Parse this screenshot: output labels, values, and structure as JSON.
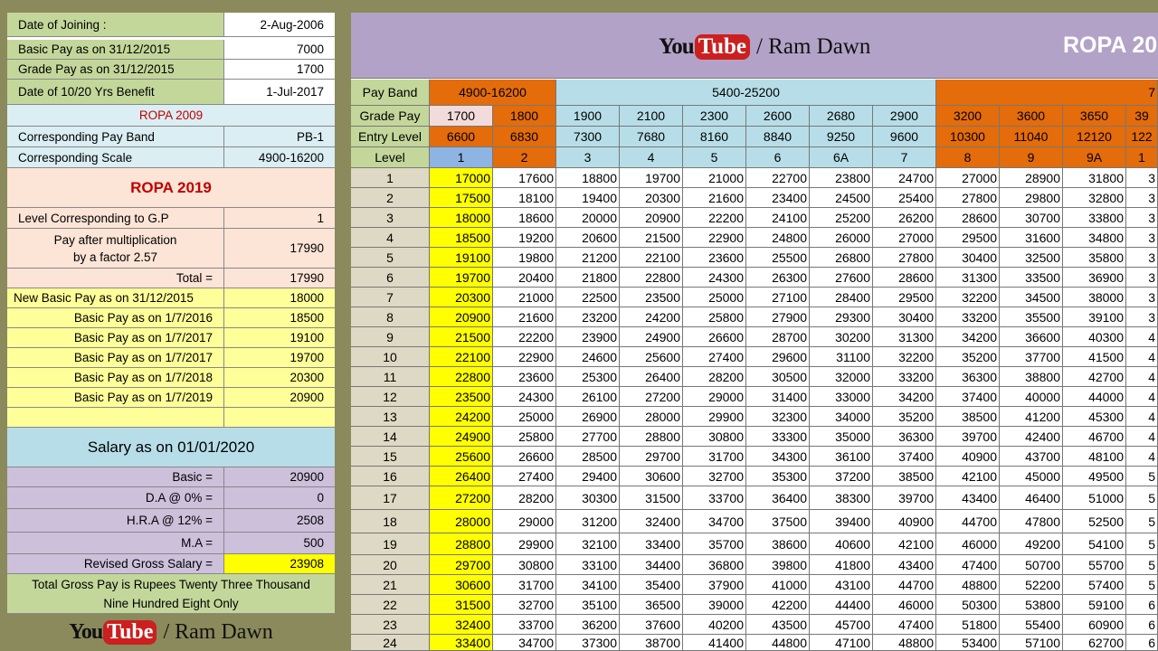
{
  "colors": {
    "green": "#c4d79b",
    "cyan": "#daeef3",
    "peach": "#fce4d6",
    "yellow": "#ffff99",
    "lavender": "#ccc0da",
    "pink": "#f2dcdb",
    "orange": "#e46c0a",
    "bright_yellow": "#ffff00",
    "purple": "#b3a2c7",
    "lightblue": "#b7dee8",
    "red": "#c00000"
  },
  "branding": {
    "you": "You",
    "tube": "Tube",
    "name": "/ Ram Dawn"
  },
  "left": {
    "date_of_joining": {
      "label": "Date of Joining :",
      "value": "2-Aug-2006"
    },
    "basic_pay_2015": {
      "label": "Basic Pay as on 31/12/2015",
      "value": "7000"
    },
    "grade_pay_2015": {
      "label": "Grade Pay as on 31/12/2015",
      "value": "1700"
    },
    "benefit_date": {
      "label": "Date of 10/20 Yrs Benefit",
      "value": "1-Jul-2017"
    },
    "ropa2009_title": "ROPA 2009",
    "pay_band": {
      "label": "Corresponding Pay Band",
      "value": "PB-1"
    },
    "scale": {
      "label": "Corresponding Scale",
      "value": "4900-16200"
    },
    "ropa2019_title": "ROPA 2019",
    "level_gp": {
      "label": "Level Corresponding to G.P",
      "value": "1"
    },
    "multiplication": {
      "line1": "Pay after multiplication",
      "line2": "by a factor 2.57",
      "value": "17990"
    },
    "total": {
      "label": "Total =",
      "value": "17990"
    },
    "new_basic": {
      "label": "New Basic Pay as on 31/12/2015",
      "value": "18000"
    },
    "bp_2016": {
      "label": "Basic Pay as on 1/7/2016",
      "value": "18500"
    },
    "bp_2017a": {
      "label": "Basic Pay as on 1/7/2017",
      "value": "19100"
    },
    "bp_2017b": {
      "label": "Basic Pay as on 1/7/2017",
      "value": "19700"
    },
    "bp_2018": {
      "label": "Basic Pay as on 1/7/2018",
      "value": "20300"
    },
    "bp_2019": {
      "label": "Basic Pay as on 1/7/2019",
      "value": "20900"
    },
    "salary_title": "Salary as on 01/01/2020",
    "basic": {
      "label": "Basic =",
      "value": "20900"
    },
    "da": {
      "label": "D.A @ 0% =",
      "value": "0"
    },
    "hra": {
      "label": "H.R.A @ 12% =",
      "value": "2508"
    },
    "ma": {
      "label": "M.A =",
      "value": "500"
    },
    "gross": {
      "label": "Revised Gross Salary =",
      "value": "23908"
    },
    "words_line1": "Total Gross Pay is Rupees Twenty Three Thousand",
    "words_line2": "Nine Hundred Eight Only"
  },
  "right": {
    "title": "ROPA 20",
    "row_labels": {
      "pay_band": "Pay Band",
      "grade_pay": "Grade Pay",
      "entry_level": "Entry Level",
      "level": "Level"
    },
    "bands": [
      "4900-16200",
      "5400-25200",
      "7"
    ],
    "grade_pay": [
      "1700",
      "1800",
      "1900",
      "2100",
      "2300",
      "2600",
      "2680",
      "2900",
      "3200",
      "3600",
      "3650",
      "39"
    ],
    "entry_level": [
      "6600",
      "6830",
      "7300",
      "7680",
      "8160",
      "8840",
      "9250",
      "9600",
      "10300",
      "11040",
      "12120",
      "122"
    ],
    "levels": [
      "1",
      "2",
      "3",
      "4",
      "5",
      "6",
      "6A",
      "7",
      "8",
      "9",
      "9A",
      "1"
    ],
    "rows": [
      [
        "1",
        "17000",
        "17600",
        "18800",
        "19700",
        "21000",
        "22700",
        "23800",
        "24700",
        "27000",
        "28900",
        "31800",
        "3"
      ],
      [
        "2",
        "17500",
        "18100",
        "19400",
        "20300",
        "21600",
        "23400",
        "24500",
        "25400",
        "27800",
        "29800",
        "32800",
        "3"
      ],
      [
        "3",
        "18000",
        "18600",
        "20000",
        "20900",
        "22200",
        "24100",
        "25200",
        "26200",
        "28600",
        "30700",
        "33800",
        "3"
      ],
      [
        "4",
        "18500",
        "19200",
        "20600",
        "21500",
        "22900",
        "24800",
        "26000",
        "27000",
        "29500",
        "31600",
        "34800",
        "3"
      ],
      [
        "5",
        "19100",
        "19800",
        "21200",
        "22100",
        "23600",
        "25500",
        "26800",
        "27800",
        "30400",
        "32500",
        "35800",
        "3"
      ],
      [
        "6",
        "19700",
        "20400",
        "21800",
        "22800",
        "24300",
        "26300",
        "27600",
        "28600",
        "31300",
        "33500",
        "36900",
        "3"
      ],
      [
        "7",
        "20300",
        "21000",
        "22500",
        "23500",
        "25000",
        "27100",
        "28400",
        "29500",
        "32200",
        "34500",
        "38000",
        "3"
      ],
      [
        "8",
        "20900",
        "21600",
        "23200",
        "24200",
        "25800",
        "27900",
        "29300",
        "30400",
        "33200",
        "35500",
        "39100",
        "3"
      ],
      [
        "9",
        "21500",
        "22200",
        "23900",
        "24900",
        "26600",
        "28700",
        "30200",
        "31300",
        "34200",
        "36600",
        "40300",
        "4"
      ],
      [
        "10",
        "22100",
        "22900",
        "24600",
        "25600",
        "27400",
        "29600",
        "31100",
        "32200",
        "35200",
        "37700",
        "41500",
        "4"
      ],
      [
        "11",
        "22800",
        "23600",
        "25300",
        "26400",
        "28200",
        "30500",
        "32000",
        "33200",
        "36300",
        "38800",
        "42700",
        "4"
      ],
      [
        "12",
        "23500",
        "24300",
        "26100",
        "27200",
        "29000",
        "31400",
        "33000",
        "34200",
        "37400",
        "40000",
        "44000",
        "4"
      ],
      [
        "13",
        "24200",
        "25000",
        "26900",
        "28000",
        "29900",
        "32300",
        "34000",
        "35200",
        "38500",
        "41200",
        "45300",
        "4"
      ],
      [
        "14",
        "24900",
        "25800",
        "27700",
        "28800",
        "30800",
        "33300",
        "35000",
        "36300",
        "39700",
        "42400",
        "46700",
        "4"
      ],
      [
        "15",
        "25600",
        "26600",
        "28500",
        "29700",
        "31700",
        "34300",
        "36100",
        "37400",
        "40900",
        "43700",
        "48100",
        "4"
      ],
      [
        "16",
        "26400",
        "27400",
        "29400",
        "30600",
        "32700",
        "35300",
        "37200",
        "38500",
        "42100",
        "45000",
        "49500",
        "5"
      ],
      [
        "17",
        "27200",
        "28200",
        "30300",
        "31500",
        "33700",
        "36400",
        "38300",
        "39700",
        "43400",
        "46400",
        "51000",
        "5"
      ],
      [
        "18",
        "28000",
        "29000",
        "31200",
        "32400",
        "34700",
        "37500",
        "39400",
        "40900",
        "44700",
        "47800",
        "52500",
        "5"
      ],
      [
        "19",
        "28800",
        "29900",
        "32100",
        "33400",
        "35700",
        "38600",
        "40600",
        "42100",
        "46000",
        "49200",
        "54100",
        "5"
      ],
      [
        "20",
        "29700",
        "30800",
        "33100",
        "34400",
        "36800",
        "39800",
        "41800",
        "43400",
        "47400",
        "50700",
        "55700",
        "5"
      ],
      [
        "21",
        "30600",
        "31700",
        "34100",
        "35400",
        "37900",
        "41000",
        "43100",
        "44700",
        "48800",
        "52200",
        "57400",
        "5"
      ],
      [
        "22",
        "31500",
        "32700",
        "35100",
        "36500",
        "39000",
        "42200",
        "44400",
        "46000",
        "50300",
        "53800",
        "59100",
        "6"
      ],
      [
        "23",
        "32400",
        "33700",
        "36200",
        "37600",
        "40200",
        "43500",
        "45700",
        "47400",
        "51800",
        "55400",
        "60900",
        "6"
      ],
      [
        "24",
        "33400",
        "34700",
        "37300",
        "38700",
        "41400",
        "44800",
        "47100",
        "48800",
        "53400",
        "57100",
        "62700",
        "6"
      ]
    ]
  }
}
